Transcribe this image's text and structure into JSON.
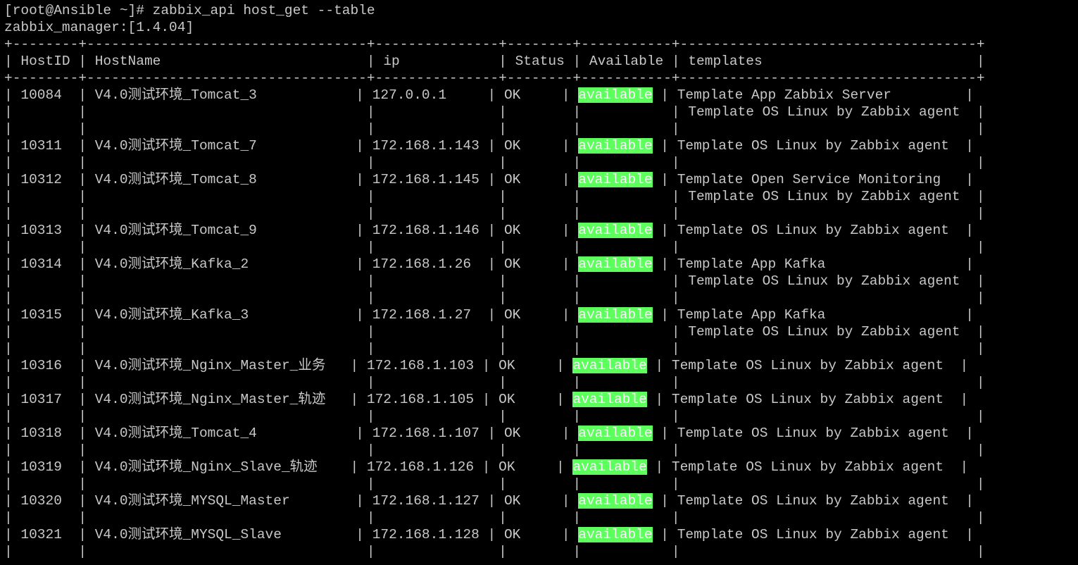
{
  "terminal": {
    "command_line": "[root@Ansible ~]# zabbix_api host_get --table",
    "manager_line": "zabbix_manager:[1.4.04]",
    "table": {
      "columns": [
        "HostID",
        "HostName",
        "ip",
        "Status",
        "Available",
        "templates"
      ],
      "rows": [
        {
          "hostid": "10084",
          "hostname": "V4.0测试环境_Tomcat_3",
          "ip": "127.0.0.1",
          "status": "OK",
          "available": "available",
          "templates": [
            "Template App Zabbix Server",
            "Template OS Linux by Zabbix agent"
          ]
        },
        {
          "hostid": "10311",
          "hostname": "V4.0测试环境_Tomcat_7",
          "ip": "172.168.1.143",
          "status": "OK",
          "available": "available",
          "templates": [
            "Template OS Linux by Zabbix agent"
          ]
        },
        {
          "hostid": "10312",
          "hostname": "V4.0测试环境_Tomcat_8",
          "ip": "172.168.1.145",
          "status": "OK",
          "available": "available",
          "templates": [
            "Template Open Service Monitoring",
            "Template OS Linux by Zabbix agent"
          ]
        },
        {
          "hostid": "10313",
          "hostname": "V4.0测试环境_Tomcat_9",
          "ip": "172.168.1.146",
          "status": "OK",
          "available": "available",
          "templates": [
            "Template OS Linux by Zabbix agent"
          ]
        },
        {
          "hostid": "10314",
          "hostname": "V4.0测试环境_Kafka_2",
          "ip": "172.168.1.26",
          "status": "OK",
          "available": "available",
          "templates": [
            "Template App Kafka",
            "Template OS Linux by Zabbix agent"
          ]
        },
        {
          "hostid": "10315",
          "hostname": "V4.0测试环境_Kafka_3",
          "ip": "172.168.1.27",
          "status": "OK",
          "available": "available",
          "templates": [
            "Template App Kafka",
            "Template OS Linux by Zabbix agent"
          ]
        },
        {
          "hostid": "10316",
          "hostname": "V4.0测试环境_Nginx_Master_业务",
          "ip": "172.168.1.103",
          "status": "OK",
          "available": "available",
          "templates": [
            "Template OS Linux by Zabbix agent"
          ]
        },
        {
          "hostid": "10317",
          "hostname": "V4.0测试环境_Nginx_Master_轨迹",
          "ip": "172.168.1.105",
          "status": "OK",
          "available": "available",
          "templates": [
            "Template OS Linux by Zabbix agent"
          ]
        },
        {
          "hostid": "10318",
          "hostname": "V4.0测试环境_Tomcat_4",
          "ip": "172.168.1.107",
          "status": "OK",
          "available": "available",
          "templates": [
            "Template OS Linux by Zabbix agent"
          ]
        },
        {
          "hostid": "10319",
          "hostname": "V4.0测试环境_Nginx_Slave_轨迹",
          "ip": "172.168.1.126",
          "status": "OK",
          "available": "available",
          "templates": [
            "Template OS Linux by Zabbix agent"
          ]
        },
        {
          "hostid": "10320",
          "hostname": "V4.0测试环境_MYSQL_Master",
          "ip": "172.168.1.127",
          "status": "OK",
          "available": "available",
          "templates": [
            "Template OS Linux by Zabbix agent"
          ]
        },
        {
          "hostid": "10321",
          "hostname": "V4.0测试环境_MYSQL_Slave",
          "ip": "172.168.1.128",
          "status": "OK",
          "available": "available",
          "templates": [
            "Template OS Linux by Zabbix agent"
          ]
        }
      ]
    }
  },
  "colors": {
    "background": "#000000",
    "text": "#c8c8c8",
    "available_highlight": "#5cff5c",
    "available_text": "#f6f6f6"
  }
}
